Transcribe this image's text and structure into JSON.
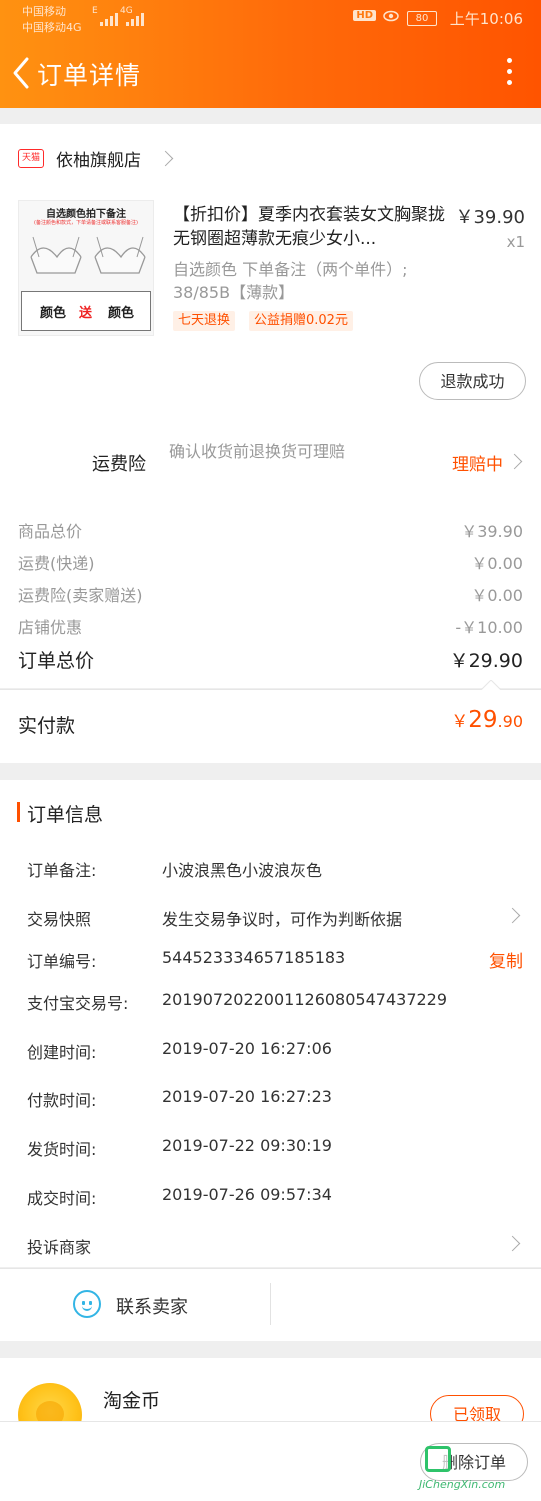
{
  "status_bar": {
    "carrier1": "中国移动",
    "carrier2": "中国移动4G",
    "net_left": "E",
    "net_right": "4G",
    "hd": "HD",
    "battery": "80",
    "time": "上午10:06"
  },
  "header": {
    "title": "订单详情"
  },
  "store": {
    "tag": "天猫",
    "name": "依柚旗舰店"
  },
  "product": {
    "image_title": "自选颜色拍下备注",
    "image_subtitle": "(备注颜色和款式，下单请备注或联系客服备注)",
    "image_left": "颜色",
    "image_mid": "送",
    "image_right": "颜色",
    "title": "【折扣价】夏季内衣套装女文胸聚拢无钢圈超薄款无痕少女小...",
    "price": "￥39.90",
    "qty": "x1",
    "spec": "自选颜色 下单备注（两个单件）; 38/85B【薄款】",
    "tags": [
      "七天退换",
      "公益捐赠0.02元"
    ],
    "refund_button": "退款成功"
  },
  "insurance": {
    "label": "运费险",
    "desc": "确认收货前退换货可理赔",
    "status": "理赔中"
  },
  "summary": {
    "rows": [
      {
        "label": "商品总价",
        "value": "￥39.90"
      },
      {
        "label": "运费(快递)",
        "value": "￥0.00"
      },
      {
        "label": "运费险(卖家赠送)",
        "value": "￥0.00"
      },
      {
        "label": "店铺优惠",
        "value": "-￥10.00"
      }
    ],
    "total_label": "订单总价",
    "total_value": "￥29.90",
    "paid_label": "实付款",
    "paid_symbol": "￥",
    "paid_int": "29",
    "paid_dec": ".90"
  },
  "order_info": {
    "title": "订单信息",
    "rows": [
      {
        "label": "订单备注:",
        "value": "小波浪黑色小波浪灰色"
      },
      {
        "label": "交易快照",
        "value": "发生交易争议时，可作为判断依据"
      },
      {
        "label": "订单编号:",
        "value": "544523334657185183",
        "action": "复制"
      },
      {
        "label": "支付宝交易号:",
        "value": "2019072022001126080547437229"
      },
      {
        "label": "创建时间:",
        "value": "2019-07-20 16:27:06"
      },
      {
        "label": "付款时间:",
        "value": "2019-07-20 16:27:23"
      },
      {
        "label": "发货时间:",
        "value": "2019-07-22 09:30:19"
      },
      {
        "label": "成交时间:",
        "value": "2019-07-26 09:57:34"
      }
    ],
    "complaint": "投诉商家"
  },
  "contact": {
    "label": "联系卖家"
  },
  "coin": {
    "label": "淘金币",
    "button": "已领取"
  },
  "bottom": {
    "delete_button": "删除订单"
  },
  "watermark": {
    "text": "JiChengXin.com"
  },
  "colors": {
    "accent": "#ff5000",
    "header_start": "#ff9211",
    "header_end": "#ff5400",
    "chat": "#33b5e5"
  }
}
